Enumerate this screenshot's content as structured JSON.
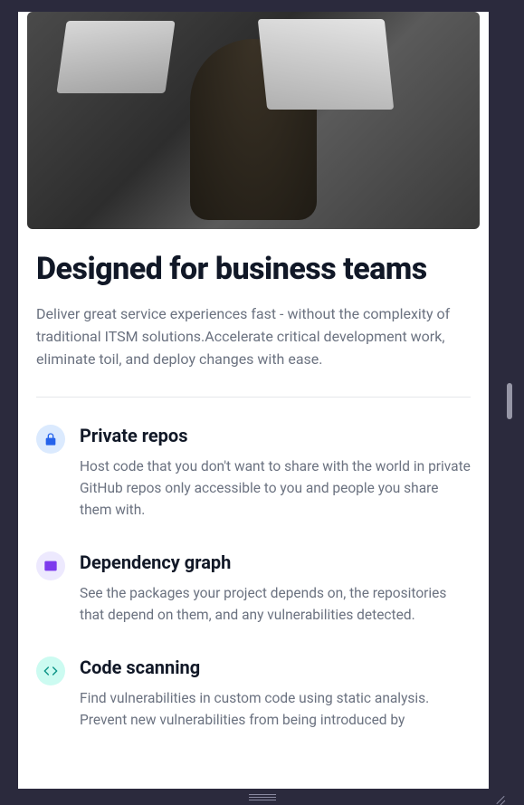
{
  "hero": {
    "alt": "office dashboard image"
  },
  "heading": "Designed for business teams",
  "lead": "Deliver great service experiences fast - without the complexity of traditional ITSM solutions.Accelerate critical development work, eliminate toil, and deploy changes with ease.",
  "features": [
    {
      "icon": "lock-icon",
      "color": "blue",
      "title": "Private repos",
      "desc": "Host code that you don't want to share with the world in private GitHub repos only accessible to you and people you share them with."
    },
    {
      "icon": "chart-icon",
      "color": "purple",
      "title": "Dependency graph",
      "desc": "See the packages your project depends on, the repositories that depend on them, and any vulnerabilities detected."
    },
    {
      "icon": "code-icon",
      "color": "teal",
      "title": "Code scanning",
      "desc": "Find vulnerabilities in custom code using static analysis. Prevent new vulnerabilities from being introduced by"
    }
  ]
}
